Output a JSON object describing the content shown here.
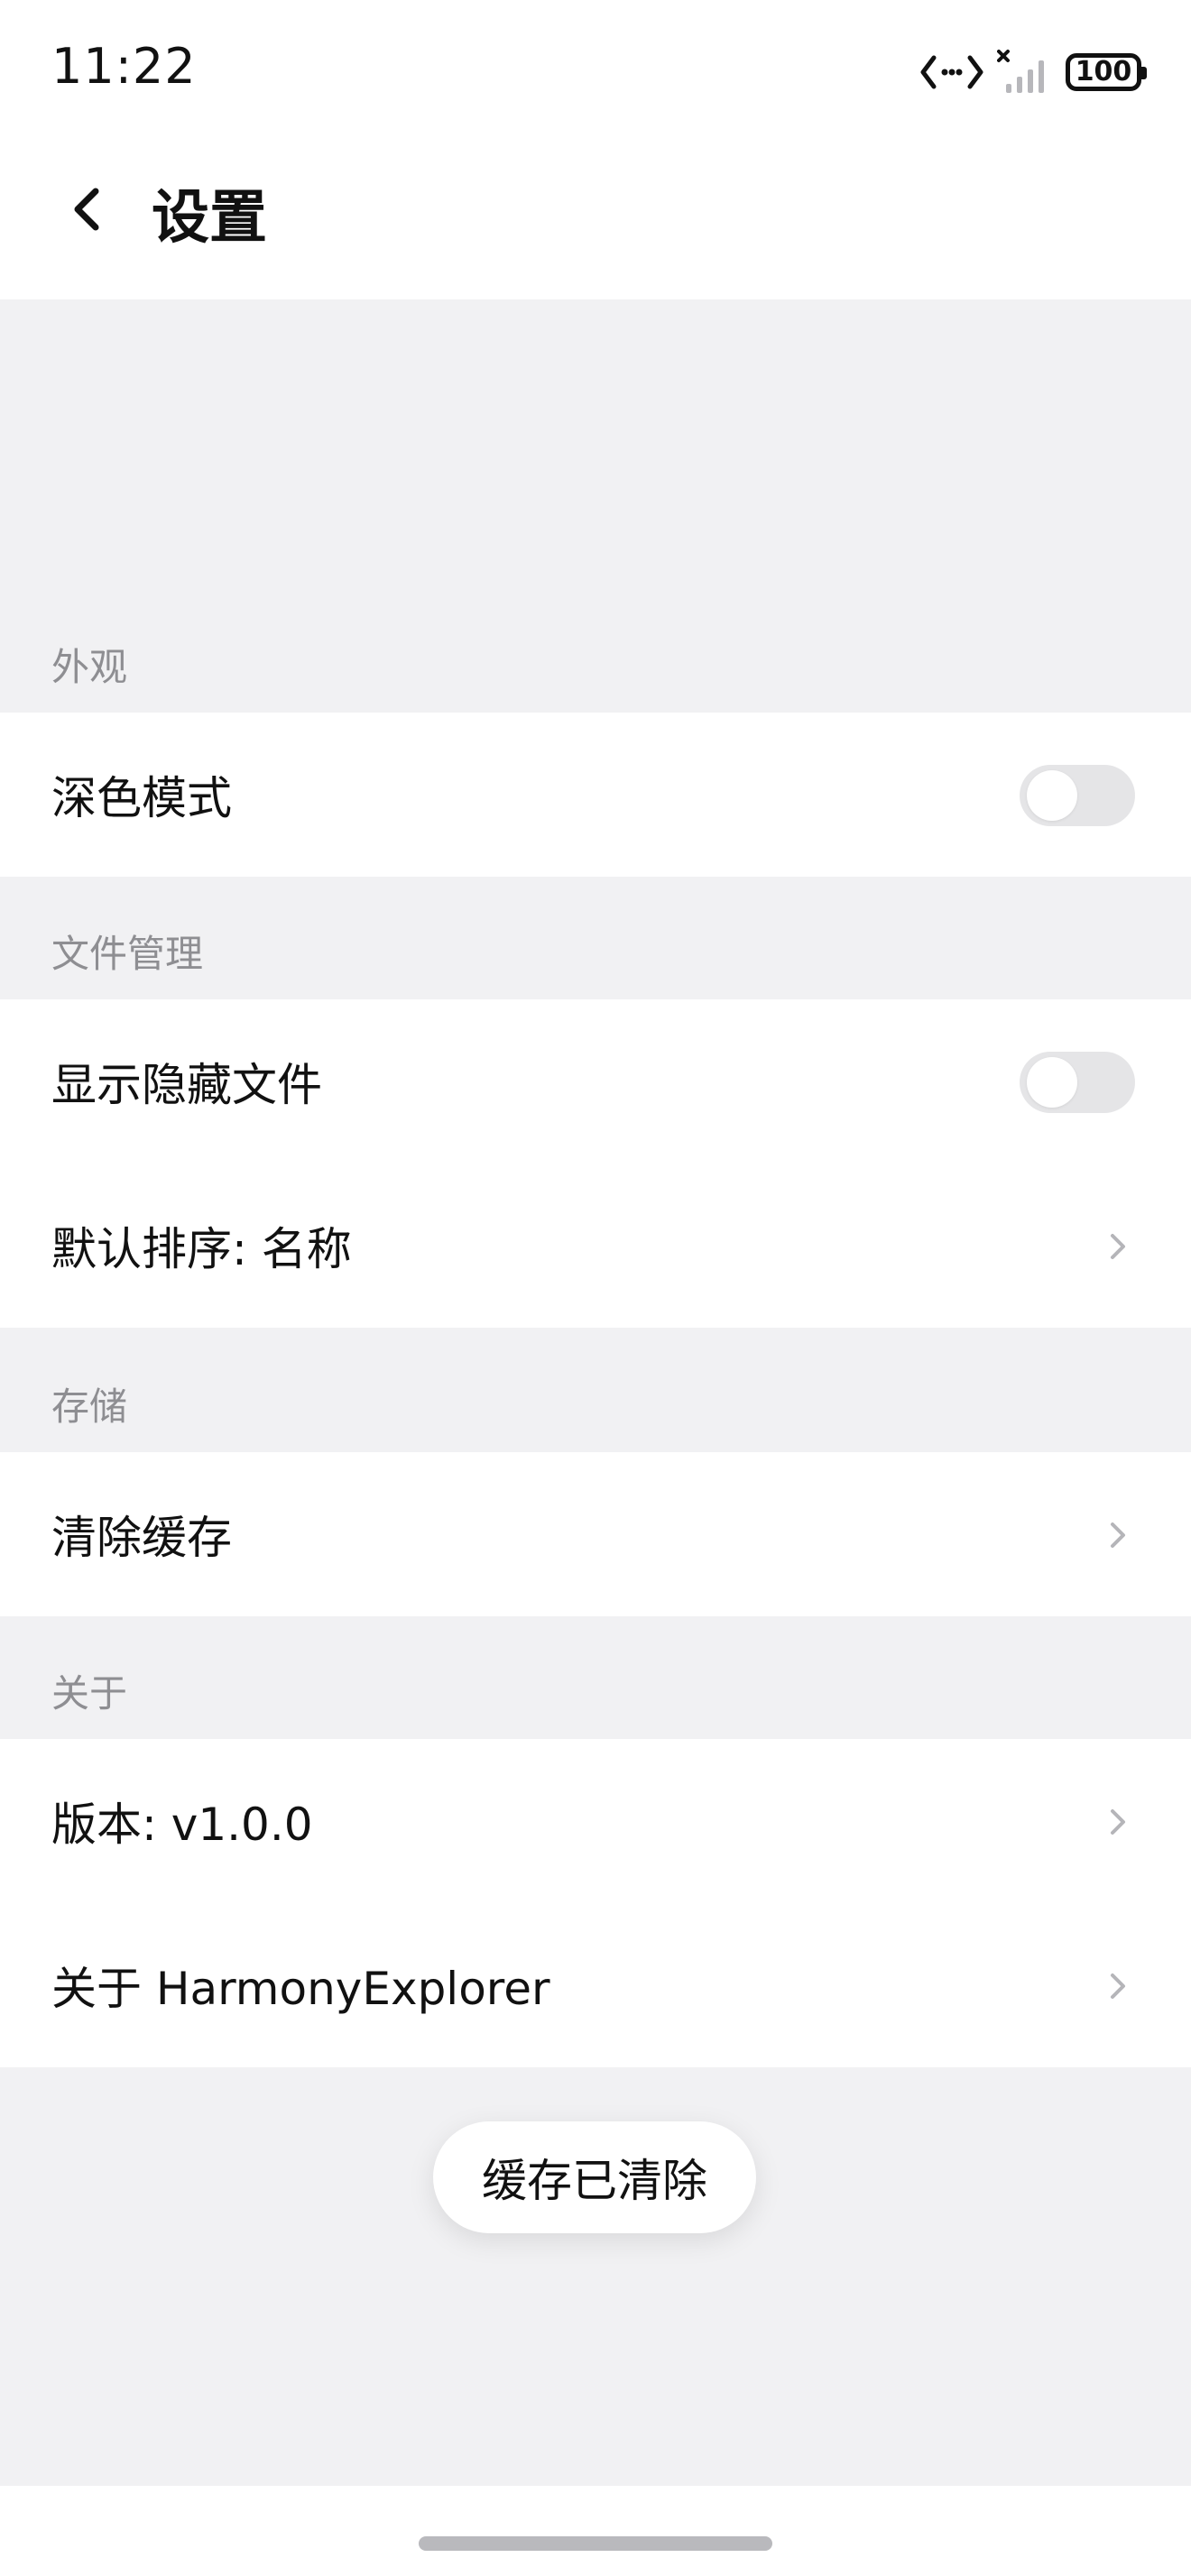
{
  "status_bar": {
    "time": "11:22",
    "battery": "100",
    "icons": [
      "data-transfer-icon",
      "no-signal-icon",
      "battery-icon"
    ]
  },
  "header": {
    "title": "设置",
    "back_icon": "back-arrow-icon"
  },
  "sections": {
    "appearance": {
      "label": "外观",
      "dark_mode": {
        "label": "深色模式",
        "enabled": false
      }
    },
    "file_management": {
      "label": "文件管理",
      "show_hidden": {
        "label": "显示隐藏文件",
        "enabled": false
      },
      "default_sort": {
        "label": "默认排序: 名称"
      }
    },
    "storage": {
      "label": "存储",
      "clear_cache": {
        "label": "清除缓存"
      }
    },
    "about": {
      "label": "关于",
      "version": {
        "label": "版本: v1.0.0"
      },
      "about_app": {
        "label": "关于 HarmonyExplorer"
      }
    }
  },
  "toast": {
    "message": "缓存已清除"
  },
  "colors": {
    "page_background": "#f1f1f3",
    "card_background": "#ffffff",
    "section_label": "#8e8e92",
    "toggle_off": "#e5e5e7"
  }
}
